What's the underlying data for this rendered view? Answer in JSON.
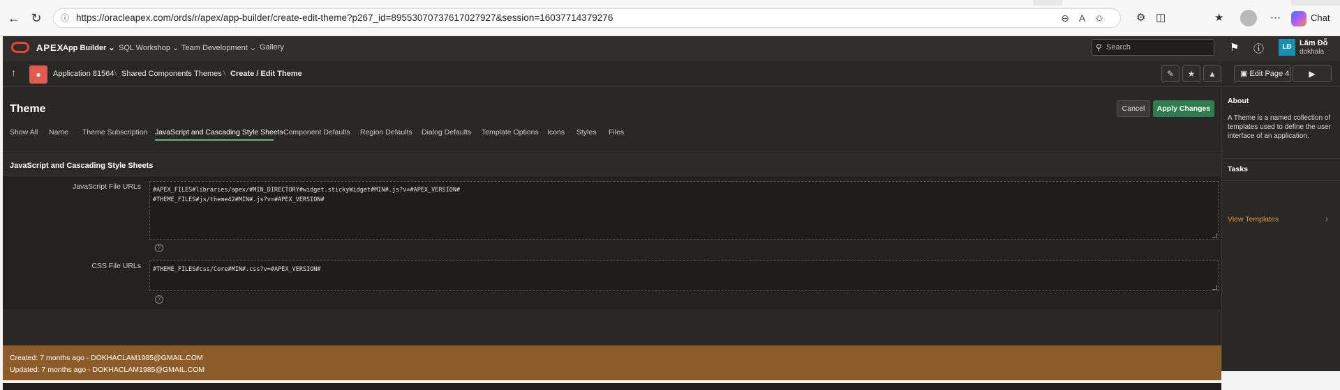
{
  "browser": {
    "url": "https://oracleapex.com/ords/r/apex/app-builder/create-edit-theme?p267_id=89553070737617027927&session=16037714379276",
    "chat_label": "Chat"
  },
  "nav": {
    "brand": "APEX",
    "menu": [
      "App Builder",
      "SQL Workshop",
      "Team Development",
      "Gallery"
    ],
    "search_placeholder": "Search",
    "user_initials": "LĐ",
    "user_name": "Lâm Đỗ",
    "user_id": "dokhala"
  },
  "breadcrumb": {
    "items": [
      "Application 81564",
      "Shared Components",
      "Themes",
      "Create / Edit Theme"
    ],
    "edit_page_label": "Edit Page 4"
  },
  "page": {
    "title": "Theme",
    "cancel_label": "Cancel",
    "apply_label": "Apply Changes",
    "tabs": [
      "Show All",
      "Name",
      "Theme Subscription",
      "JavaScript and Cascading Style Sheets",
      "Component Defaults",
      "Region Defaults",
      "Dialog Defaults",
      "Template Options",
      "Icons",
      "Styles",
      "Files"
    ],
    "active_tab": "JavaScript and Cascading Style Sheets"
  },
  "region": {
    "title": "JavaScript and Cascading Style Sheets",
    "js_label": "JavaScript File URLs",
    "js_line1": "#APEX_FILES#libraries/apex/#MIN_DIRECTORY#widget.stickyWidget#MIN#.js?v=#APEX_VERSION#",
    "js_line2": "#THEME_FILES#js/theme42#MIN#.js?v=#APEX_VERSION#",
    "css_label": "CSS File URLs",
    "css_value": "#THEME_FILES#css/Core#MIN#.css?v=#APEX_VERSION#"
  },
  "audit": {
    "created": "Created: 7 months ago - DOKHACLAM1985@GMAIL.COM",
    "updated": "Updated: 7 months ago - DOKHACLAM1985@GMAIL.COM"
  },
  "sidebar": {
    "about_title": "About",
    "about_text": "A Theme is a named collection of templates used to define the user interface of an application.",
    "tasks_title": "Tasks",
    "tasks_link": "View Templates"
  },
  "colors": {
    "accent_green": "#2f7d4d",
    "audit_bar": "#8c5c2b",
    "link_orange": "#e29a3a"
  }
}
